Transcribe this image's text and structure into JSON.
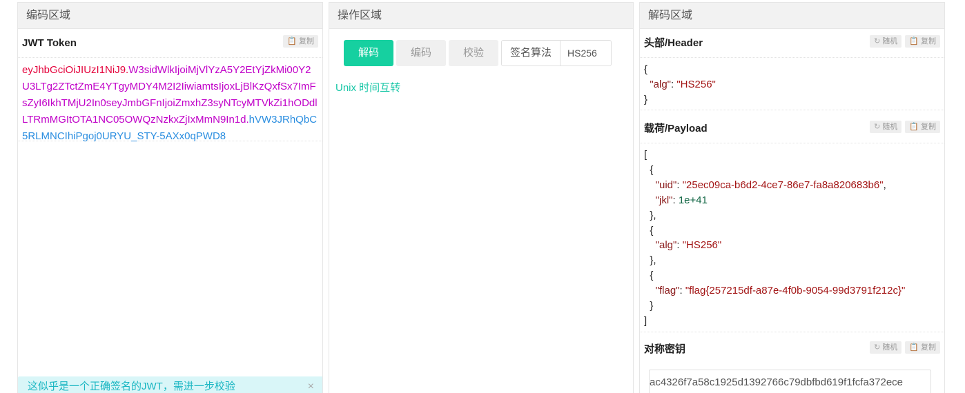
{
  "encode": {
    "title": "编码区域",
    "token_label": "JWT Token",
    "copy_label": "复制",
    "token_header": "eyJhbGciOiJIUzI1NiJ9.",
    "token_payload": "W3sidWlkIjoiMjVlYzA5Y2EtYjZkMi00Y2U3LTg2ZTctZmE4YTgyMDY4M2I2IiwiamtsIjoxLjBlKzQxfSx7ImFsZyI6IkhTMjU2In0seyJmbGFnIjoiZmxhZ3syNTcyMTVkZi1hODdlLTRmMGItOTA1NC05OWQzNzkxZjIxMmN9In1d.",
    "token_signature": "hVW3JRhQbC5RLMNCIhiPgoj0URYU_STY-5AXx0qPWD8",
    "alert_text": "这似乎是一个正确签名的JWT，需进一步校验",
    "alert_close": "×"
  },
  "operation": {
    "title": "操作区域",
    "decode_label": "解码",
    "encode_label": "编码",
    "verify_label": "校验",
    "alg_label": "签名算法",
    "alg_value": "HS256",
    "unix_link": "Unix 时间互转"
  },
  "decode": {
    "title": "解码区域",
    "random_label": "随机",
    "copy_label": "复制",
    "header_label": "头部/Header",
    "payload_label": "载荷/Payload",
    "secret_label": "对称密钥",
    "secret_value": "ac4326f7a58c1925d1392766c79dbfbd619f1fcfa372ece",
    "header_json": {
      "open": "{",
      "alg_key": "\"alg\"",
      "alg_val": "\"HS256\"",
      "close": "}"
    },
    "payload_json": {
      "uid_key": "\"uid\"",
      "uid_val": "\"25ec09ca-b6d2-4ce7-86e7-fa8a820683b6\"",
      "jkl_key": "\"jkl\"",
      "jkl_val": "1e+41",
      "alg_key": "\"alg\"",
      "alg_val": "\"HS256\"",
      "flag_key": "\"flag\"",
      "flag_val": "\"flag{257215df-a87e-4f0b-9054-99d3791f212c}\""
    }
  },
  "colors": {
    "accent": "#16d0a0",
    "token_header": "#e4003a",
    "token_payload": "#c000c8",
    "token_signature": "#2b8ee0"
  }
}
